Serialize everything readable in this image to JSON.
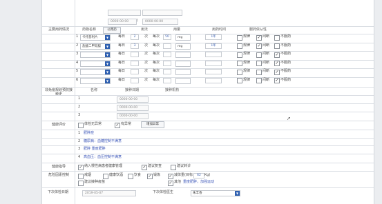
{
  "top_fields": {
    "date_from": "0000-00-00",
    "date_to": "0000-00-00"
  },
  "medication": {
    "section_label": "主要用药情况",
    "headers": {
      "name": "药物名称",
      "lookup_button": "公用药",
      "usage": "用法",
      "dosage": "用量",
      "time": "用药时间",
      "compliance": "服药依从性"
    },
    "rows": [
      {
        "name": "卡托普利片",
        "freq": "每日",
        "times": "2",
        "each_label": "次",
        "per": "每次",
        "amount": "50",
        "unit": "mg",
        "duration": "1年",
        "regular": "规律",
        "intermittent": "间断",
        "none": "不服药",
        "regular_on": false,
        "intermittent_on": true,
        "none_on": false
      },
      {
        "name": "盐酸二甲双胍",
        "freq": "每日",
        "times": "3",
        "each_label": "次",
        "per": "每次",
        "amount": "",
        "unit": "mg",
        "duration": "1年",
        "regular": "规律",
        "intermittent": "间断",
        "none": "不服药",
        "regular_on": false,
        "intermittent_on": true,
        "none_on": false
      },
      {
        "name": "",
        "freq": "每日",
        "times": "",
        "each_label": "次",
        "per": "每次",
        "amount": "",
        "unit": "",
        "duration": "",
        "regular": "规律",
        "intermittent": "间断",
        "none": "不服药",
        "regular_on": false,
        "intermittent_on": false,
        "none_on": true
      },
      {
        "name": "",
        "freq": "每日",
        "times": "",
        "each_label": "次",
        "per": "每次",
        "amount": "",
        "unit": "",
        "duration": "",
        "regular": "规律",
        "intermittent": "间断",
        "none": "不服药",
        "regular_on": false,
        "intermittent_on": false,
        "none_on": true
      },
      {
        "name": "",
        "freq": "每日",
        "times": "",
        "each_label": "次",
        "per": "每次",
        "amount": "",
        "unit": "",
        "duration": "",
        "regular": "规律",
        "intermittent": "间断",
        "none": "不服药",
        "regular_on": false,
        "intermittent_on": false,
        "none_on": true
      },
      {
        "name": "",
        "freq": "每日",
        "times": "",
        "each_label": "次",
        "per": "每次",
        "amount": "",
        "unit": "",
        "duration": "",
        "regular": "规律",
        "intermittent": "间断",
        "none": "不服药",
        "regular_on": false,
        "intermittent_on": false,
        "none_on": true
      }
    ]
  },
  "vaccine": {
    "section_label": "非免疫规划预防接种史",
    "headers": {
      "name": "名称",
      "date": "接种日期",
      "org": "接种机构"
    },
    "rows": [
      {
        "num": "1",
        "date": "0000-00-00"
      },
      {
        "num": "2",
        "date": "0000-00-00"
      },
      {
        "num": "3",
        "date": "0000-00-00"
      }
    ]
  },
  "health_eval": {
    "section_label": "健康评价",
    "opt1": "体检无异常",
    "opt2": "有异常",
    "add_button": "增加异常",
    "items": [
      {
        "num": "1",
        "text": "肥胖症"
      },
      {
        "num": "2",
        "text": "糖尿病：血糖控制不满意"
      },
      {
        "num": "3",
        "text": "肥胖 重度肥胖"
      },
      {
        "num": "4",
        "text": "高血压：血压控制不满意"
      }
    ]
  },
  "guidance": {
    "section_label": "健康指导",
    "items": [
      {
        "text": "纳入慢性病患者健康管理",
        "on": true
      },
      {
        "text": "建议复查",
        "on": true
      },
      {
        "text": "建议转诊",
        "on": false
      }
    ]
  },
  "risk": {
    "section_label": "危险因素控制",
    "items": [
      {
        "text": "戒烟",
        "on": false
      },
      {
        "text": "健康饮酒",
        "on": false
      },
      {
        "text": "饮食",
        "on": false
      },
      {
        "text": "锻炼",
        "on": true
      },
      {
        "text": "减体重(目标",
        "on": true
      },
      {
        "text": "Kg)",
        "on": false
      },
      {
        "text": "建议接种疫苗",
        "on": false
      },
      {
        "text": "其他",
        "on": true
      }
    ],
    "weight_target": "62",
    "other_text": "重度肥胖，加强运动"
  },
  "footer": {
    "next_date_label": "下次体检日期",
    "next_date": "2019-05-07",
    "doctor_label": "下次体检医生",
    "doctor": "朱丰香"
  }
}
